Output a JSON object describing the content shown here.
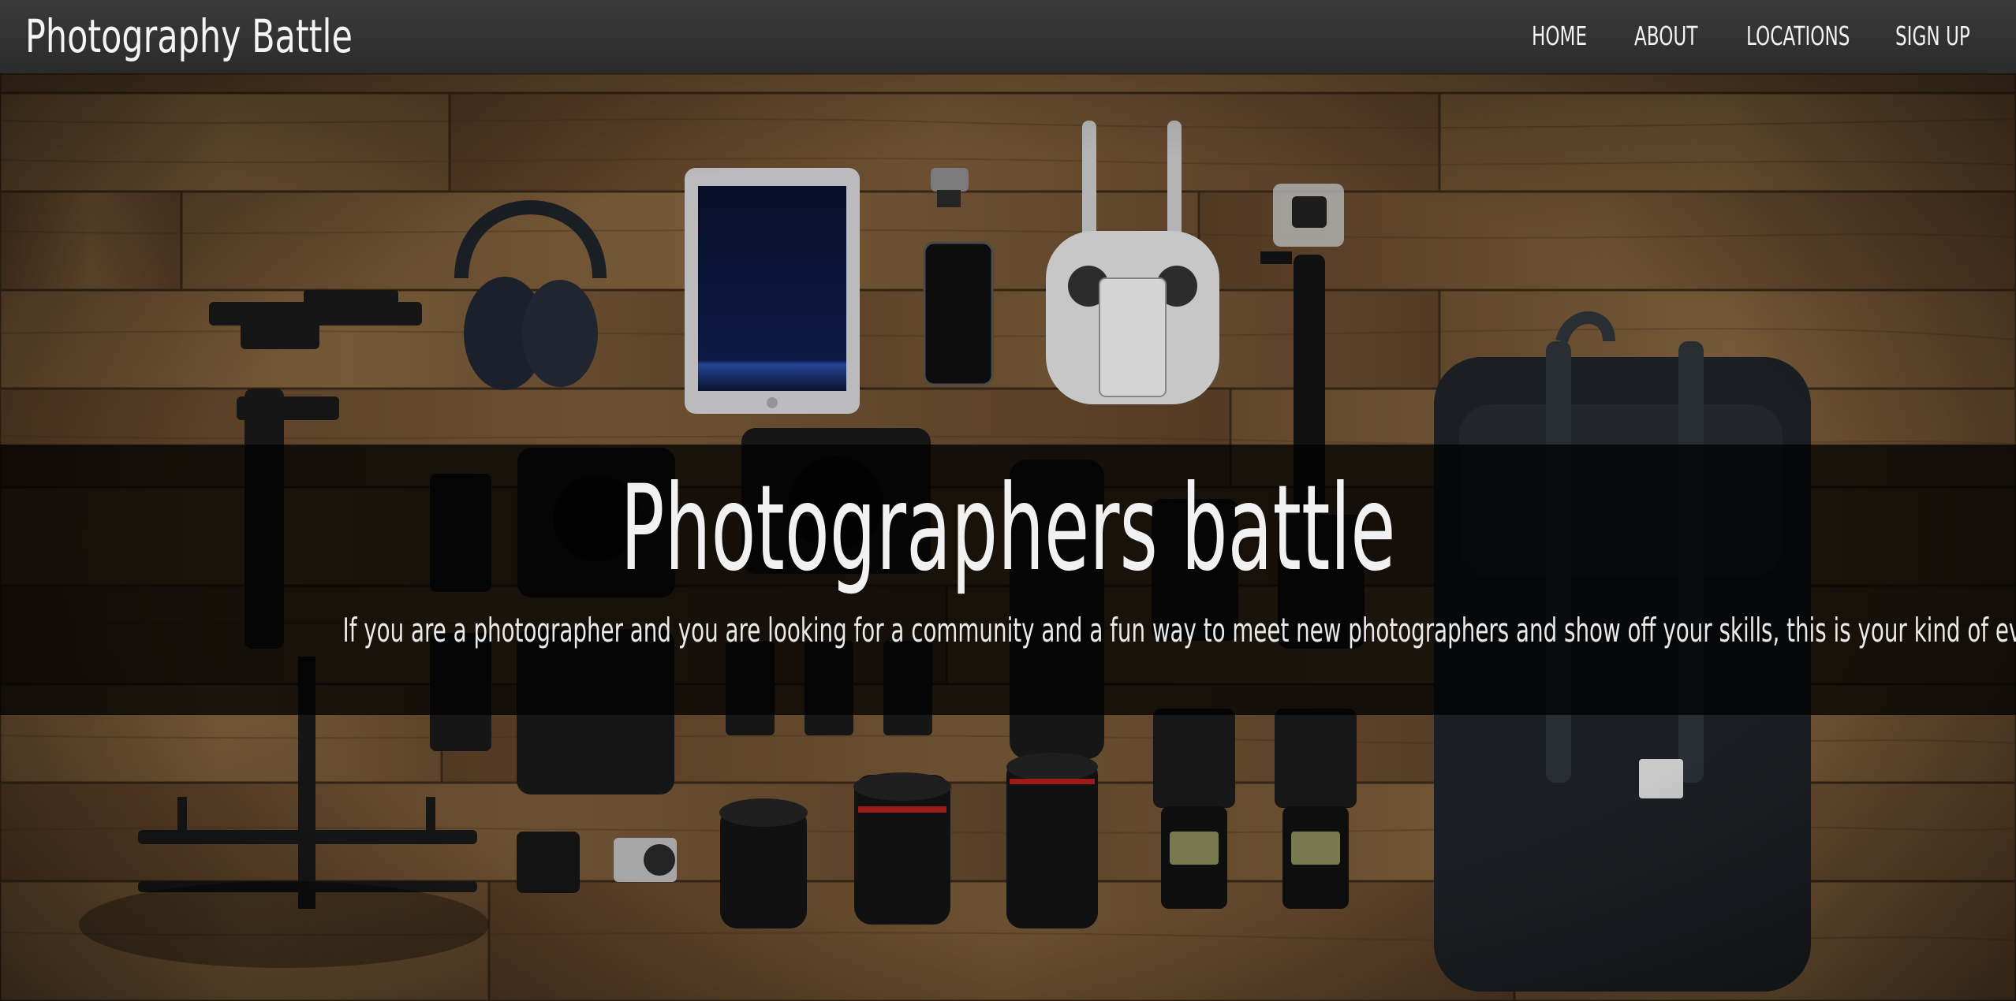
{
  "navbar": {
    "brand": "Photography Battle",
    "links": {
      "home": "HOME",
      "about": "ABOUT",
      "locations": "LOCATIONS",
      "signup": "SIGN UP"
    }
  },
  "hero": {
    "title": "Photographers battle",
    "subtitle": "If you are a photographer and you are looking for a community and a fun way to meet new photographers and show off your skills, this is your kind of event"
  },
  "colors": {
    "navbar_bg": "#2f2f2f",
    "nav_text": "#f2f2f2",
    "band_overlay": "rgba(0,0,0,0.76)",
    "wood": "#7a5a36"
  }
}
